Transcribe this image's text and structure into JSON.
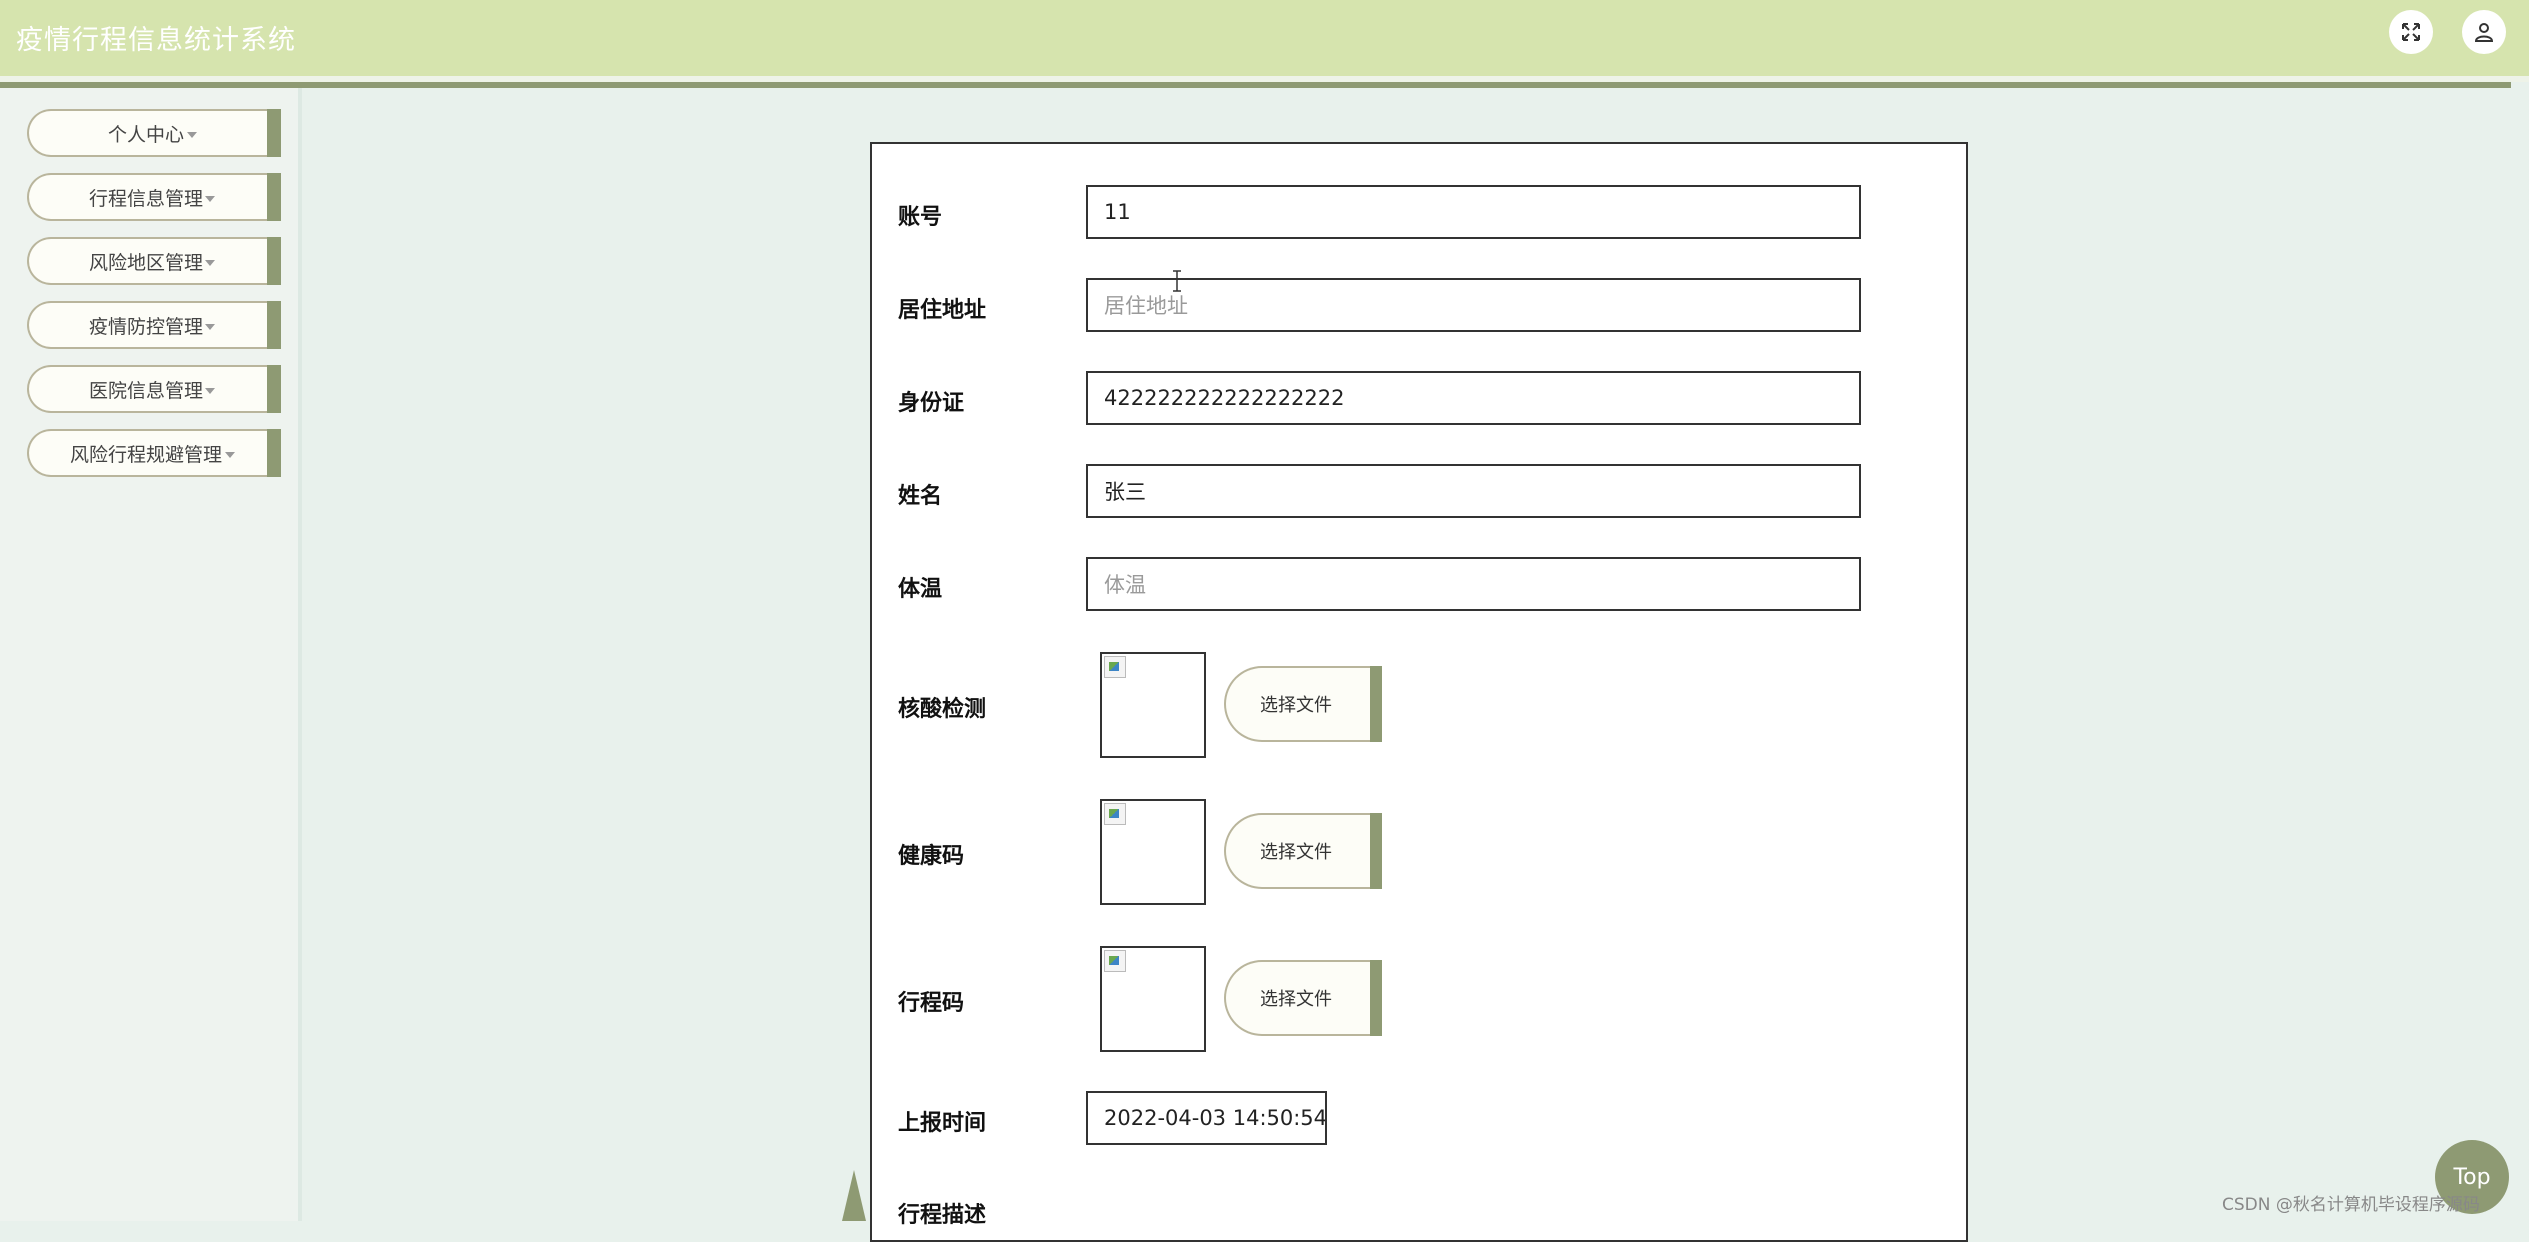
{
  "header": {
    "title": "疫情行程信息统计系统",
    "buttons": [
      {
        "icon": "fullscreen-icon"
      },
      {
        "icon": "user-icon"
      }
    ]
  },
  "sidebar": {
    "items": [
      {
        "label": "个人中心"
      },
      {
        "label": "行程信息管理"
      },
      {
        "label": "风险地区管理"
      },
      {
        "label": "疫情防控管理"
      },
      {
        "label": "医院信息管理"
      },
      {
        "label": "风险行程规避管理"
      }
    ]
  },
  "form": {
    "account": {
      "label": "账号",
      "value": "11"
    },
    "address": {
      "label": "居住地址",
      "placeholder": "居住地址",
      "value": ""
    },
    "id_card": {
      "label": "身份证",
      "value": "422222222222222222"
    },
    "name": {
      "label": "姓名",
      "value": "张三"
    },
    "temperature": {
      "label": "体温",
      "placeholder": "体温",
      "value": ""
    },
    "nucleic_test": {
      "label": "核酸检测",
      "button": "选择文件"
    },
    "health_code": {
      "label": "健康码",
      "button": "选择文件"
    },
    "trip_code": {
      "label": "行程码",
      "button": "选择文件"
    },
    "report_time": {
      "label": "上报时间",
      "value": "2022-04-03 14:50:54"
    },
    "trip_desc": {
      "label": "行程描述"
    }
  },
  "top_button": "Top",
  "watermark": "CSDN @秋名计算机毕设程序源码",
  "colors": {
    "header_bg": "#d6e4ae",
    "accent": "#8e9a73",
    "page_bg": "#e8f1ec"
  }
}
